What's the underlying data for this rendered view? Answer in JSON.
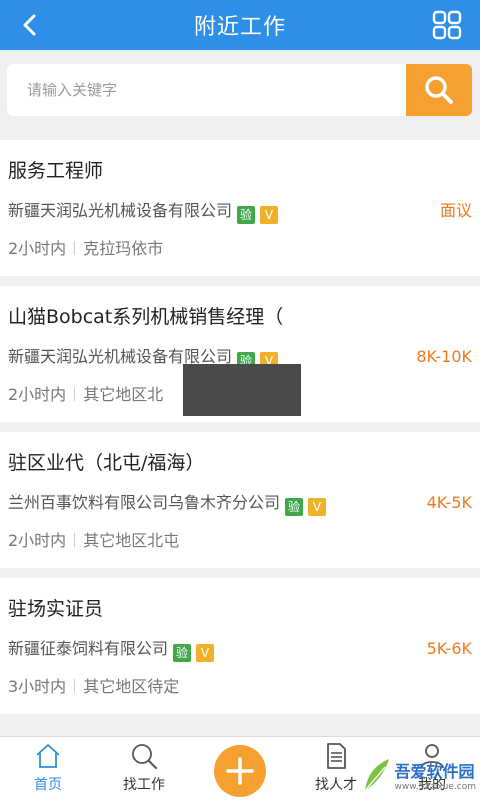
{
  "header": {
    "title": "附近工作",
    "back_icon": "back-arrow-icon",
    "menu_icon": "grid-icon"
  },
  "search": {
    "placeholder": "请输入关键字",
    "value": "",
    "button_icon": "search-icon"
  },
  "jobs": [
    {
      "title": "服务工程师",
      "company": "新疆天润弘光机械设备有限公司",
      "badges": [
        "验",
        "V"
      ],
      "salary": "面议",
      "time": "2小时内",
      "location": "克拉玛依市"
    },
    {
      "title": "山猫Bobcat系列机械销售经理（",
      "company": "新疆天润弘光机械设备有限公司",
      "badges": [
        "验",
        "V"
      ],
      "salary": "8K-10K",
      "time": "2小时内",
      "location": "其它地区北"
    },
    {
      "title": "驻区业代（北屯/福海）",
      "company": "兰州百事饮料有限公司乌鲁木齐分公司",
      "badges": [
        "验",
        "V"
      ],
      "salary": "4K-5K",
      "time": "2小时内",
      "location": "其它地区北屯"
    },
    {
      "title": "驻场实证员",
      "company": "新疆征泰饲料有限公司",
      "badges": [
        "验",
        "V"
      ],
      "salary": "5K-6K",
      "time": "3小时内",
      "location": "其它地区待定"
    }
  ],
  "nav": {
    "home": "首页",
    "find_job": "找工作",
    "find_talent": "找人才",
    "mine": "我的"
  },
  "watermark": {
    "title": "吾爱软件园",
    "sub": "www.52zixue.com"
  },
  "colors": {
    "primary": "#2d8fe6",
    "accent": "#f5a030",
    "salary": "#f07a1c"
  }
}
